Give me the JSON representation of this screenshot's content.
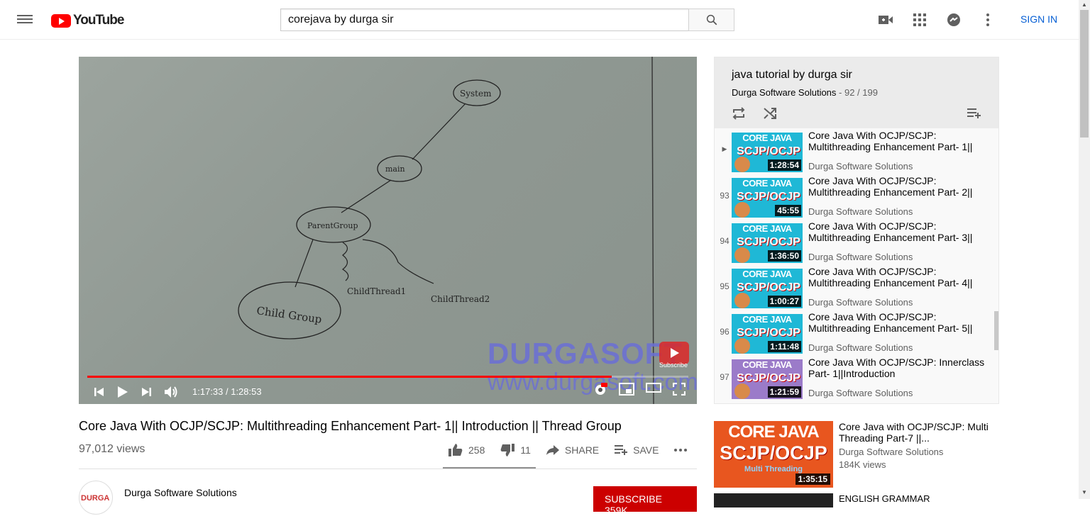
{
  "header": {
    "logo_text": "YouTube",
    "search_value": "corejava by durga sir",
    "sign_in": "SIGN IN"
  },
  "player": {
    "time": "1:17:33 / 1:28:53",
    "progress_fraction": 0.872,
    "board": {
      "system": "System",
      "main": "main",
      "parent": "ParentGroup",
      "child_group": "Child Group",
      "child_thread1": "ChildThread1",
      "child_thread2": "ChildThread2"
    },
    "watermark_title": "DURGASOFT",
    "watermark_url": "www.durgasoft.com",
    "watermark_subscribe": "Subscribe"
  },
  "video": {
    "title": "Core Java With OCJP/SCJP: Multithreading Enhancement Part- 1|| Introduction || Thread Group",
    "views": "97,012 views",
    "likes": "258",
    "dislikes": "11",
    "share": "SHARE",
    "save": "SAVE"
  },
  "channel": {
    "name": "Durga Software Solutions",
    "avatar_text": "DURGA",
    "subscribe": "SUBSCRIBE 359K"
  },
  "playlist": {
    "title": "java tutorial by durga sir",
    "owner": "Durga Software Solutions",
    "position": " - 92 / 199",
    "items": [
      {
        "index": "▶",
        "title": "Core Java With OCJP/SCJP: Multithreading Enhancement Part- 1||",
        "channel": "Durga Software Solutions",
        "duration": "1:28:54",
        "thumb_top": "CORE JAVA",
        "thumb_main": "SCJP/OCJP"
      },
      {
        "index": "93",
        "title": "Core Java With OCJP/SCJP: Multithreading Enhancement Part- 2||",
        "channel": "Durga Software Solutions",
        "duration": "45:55",
        "thumb_top": "CORE JAVA",
        "thumb_main": "SCJP/OCJP"
      },
      {
        "index": "94",
        "title": "Core Java With OCJP/SCJP: Multithreading Enhancement Part- 3||",
        "channel": "Durga Software Solutions",
        "duration": "1:36:50",
        "thumb_top": "CORE JAVA",
        "thumb_main": "SCJP/OCJP"
      },
      {
        "index": "95",
        "title": "Core Java With OCJP/SCJP: Multithreading Enhancement Part- 4||",
        "channel": "Durga Software Solutions",
        "duration": "1:00:27",
        "thumb_top": "CORE JAVA",
        "thumb_main": "SCJP/OCJP"
      },
      {
        "index": "96",
        "title": "Core Java With OCJP/SCJP: Multithreading Enhancement Part- 5||",
        "channel": "Durga Software Solutions",
        "duration": "1:11:48",
        "thumb_top": "CORE JAVA",
        "thumb_main": "SCJP/OCJP"
      },
      {
        "index": "97",
        "title": "Core Java With OCJP/SCJP: Innerclass Part- 1||Introduction",
        "channel": "Durga Software Solutions",
        "duration": "1:21:59",
        "thumb_top": "CORE JAVA",
        "thumb_main": "SCJP/OCJP"
      }
    ]
  },
  "recommended": [
    {
      "title": "Core Java with OCJP/SCJP: Multi Threading Part-7 ||...",
      "channel": "Durga Software Solutions",
      "views": "184K views",
      "duration": "1:35:15",
      "thumb_top": "CORE JAVA",
      "thumb_main": "SCJP/OCJP",
      "thumb_sub": "Multi Threading"
    },
    {
      "title": "ENGLISH GRAMMAR"
    }
  ],
  "colors": {
    "brand_red": "#ff0000",
    "link_blue": "#065fd4",
    "subscribe_red": "#cc0000"
  }
}
